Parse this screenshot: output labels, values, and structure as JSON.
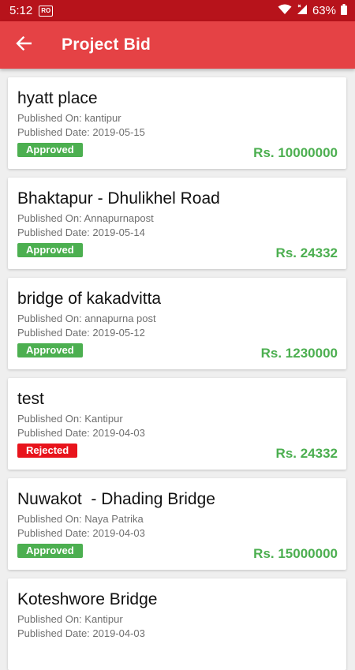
{
  "status_bar": {
    "time": "5:12",
    "notif_badge": "RO",
    "battery": "63%"
  },
  "app_bar": {
    "title": "Project Bid"
  },
  "colors": {
    "status_bar": "#b7131b",
    "app_bar": "#e54245",
    "approved": "#4caf50",
    "rejected": "#e8141c",
    "amount": "#4caf50"
  },
  "bids": [
    {
      "title": "hyatt place",
      "published_on": "Published On: kantipur",
      "published_date": "Published Date: 2019-05-15",
      "status": "Approved",
      "amount": "Rs. 10000000"
    },
    {
      "title": "Bhaktapur - Dhulikhel Road",
      "published_on": "Published On: Annapurnapost",
      "published_date": "Published Date: 2019-05-14",
      "status": "Approved",
      "amount": "Rs. 24332"
    },
    {
      "title": "bridge of kakadvitta",
      "published_on": "Published On: annapurna post",
      "published_date": "Published Date: 2019-05-12",
      "status": "Approved",
      "amount": "Rs. 1230000"
    },
    {
      "title": "test",
      "published_on": "Published On: Kantipur",
      "published_date": "Published Date: 2019-04-03",
      "status": "Rejected",
      "amount": "Rs. 24332"
    },
    {
      "title": "Nuwakot  - Dhading Bridge",
      "published_on": "Published On: Naya Patrika",
      "published_date": "Published Date: 2019-04-03",
      "status": "Approved",
      "amount": "Rs. 15000000"
    },
    {
      "title": "Koteshwore Bridge",
      "published_on": "Published On: Kantipur",
      "published_date": "Published Date: 2019-04-03",
      "status": "",
      "amount": ""
    }
  ]
}
